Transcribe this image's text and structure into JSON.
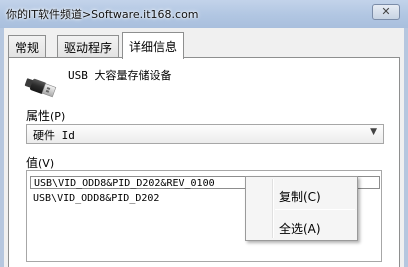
{
  "window": {
    "title": "你的IT软件频道>Software.it168.com",
    "close_symbol": "✕"
  },
  "tabs": [
    {
      "label": "常规",
      "active": false
    },
    {
      "label": "驱动程序",
      "active": false
    },
    {
      "label": "详细信息",
      "active": true
    }
  ],
  "device": {
    "name": "USB 大容量存储设备",
    "icon": "usb-plug-icon"
  },
  "property": {
    "label": "属性",
    "shortcut": "(P)",
    "selected": "硬件 Id",
    "chevron": "▼"
  },
  "values": {
    "label": "值",
    "shortcut": "(V)",
    "items": [
      "USB\\VID_ODD8&PID_D202&REV_0100",
      "USB\\VID_ODD8&PID_D202"
    ]
  },
  "context_menu": {
    "items": [
      "复制(C)",
      "全选(A)"
    ]
  },
  "colors": {
    "titlebar": "#b1c6e2",
    "dialog_bg": "#f0f0f0",
    "tab_page_bg": "#ffffff"
  }
}
